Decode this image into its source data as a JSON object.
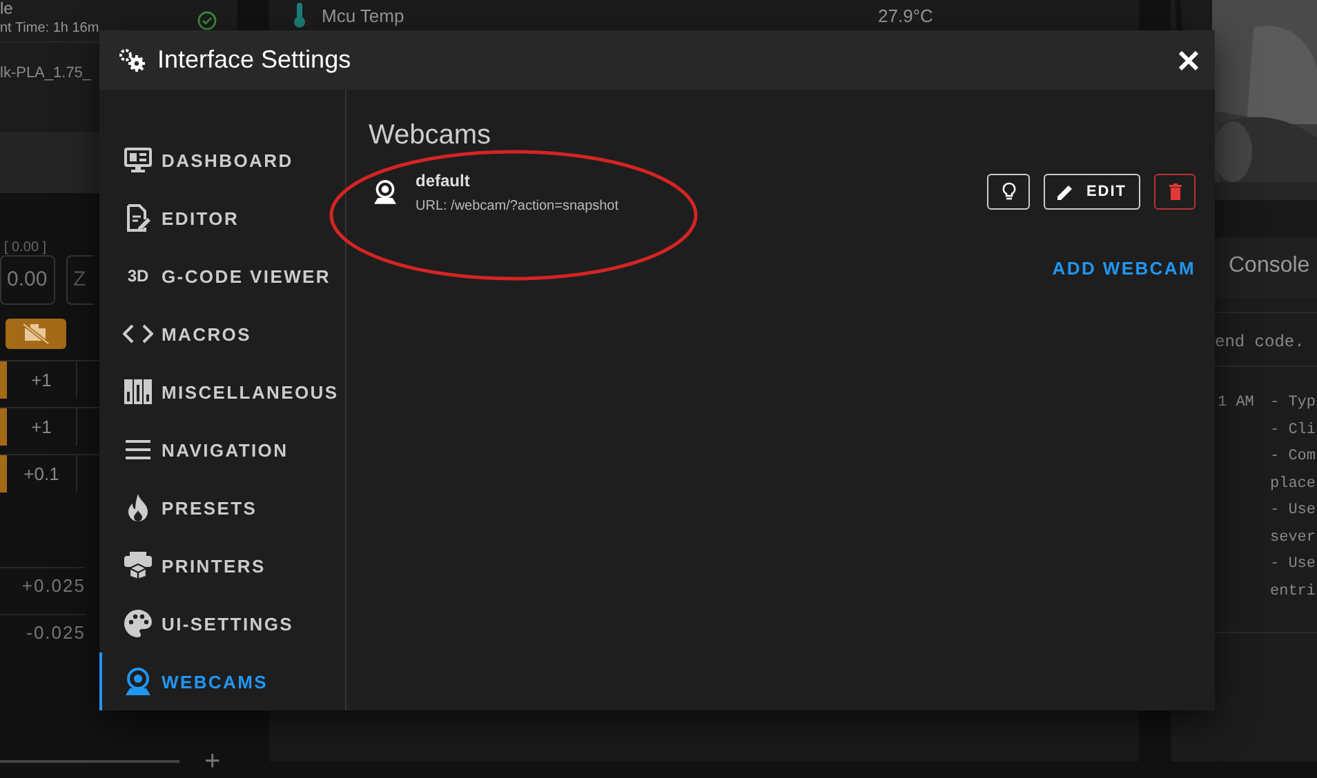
{
  "background": {
    "left_panel": {
      "status_text": "le",
      "print_time": "nt Time: 1h 16m",
      "filename": "lk-PLA_1.75_",
      "position_label": "[ 0.00 ]",
      "position_value": "0.00",
      "axis_label": "Z",
      "step_rows": [
        {
          "label": "+1"
        },
        {
          "label": "+1"
        },
        {
          "label": "+0.1"
        }
      ],
      "offset_rows": [
        {
          "label": "+0.025"
        },
        {
          "label": "-0.025"
        }
      ],
      "plus": "+"
    },
    "sensor": {
      "name": "Mcu Temp",
      "value": "27.9°C"
    },
    "console": {
      "title": "Console",
      "input_placeholder": "end code.",
      "time": "1 AM",
      "lines": [
        "- Typ",
        "- Cli",
        "- Com",
        "place",
        "- Use",
        "sever",
        "- Use",
        "entri"
      ]
    }
  },
  "dialog": {
    "title": "Interface Settings",
    "nav": [
      {
        "label": "DASHBOARD",
        "selected": false
      },
      {
        "label": "EDITOR",
        "selected": false
      },
      {
        "label": "G-CODE VIEWER",
        "badge": "3D",
        "selected": false
      },
      {
        "label": "MACROS",
        "selected": false
      },
      {
        "label": "MISCELLANEOUS",
        "selected": false
      },
      {
        "label": "NAVIGATION",
        "selected": false
      },
      {
        "label": "PRESETS",
        "selected": false
      },
      {
        "label": "PRINTERS",
        "selected": false
      },
      {
        "label": "UI-SETTINGS",
        "selected": false
      },
      {
        "label": "WEBCAMS",
        "selected": true
      }
    ],
    "section_title": "Webcams",
    "webcams": [
      {
        "name": "default",
        "url": "URL: /webcam/?action=snapshot",
        "edit_label": "EDIT"
      }
    ],
    "add_button": "ADD WEBCAM"
  }
}
